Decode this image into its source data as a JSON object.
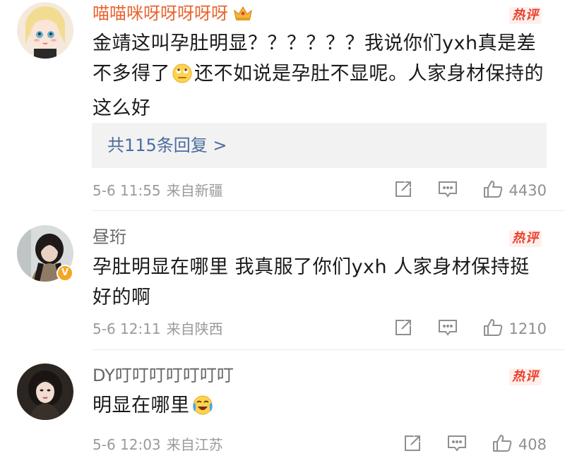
{
  "hot_label": "热评",
  "comments": [
    {
      "username": "喵喵咪呀呀呀呀呀",
      "content_part1": "金靖这叫孕肚明显？？？？？？我说你们yxh真是差不多得了",
      "content_part2": "还不如说是孕肚不显呢。人家身材保持的这么好",
      "replies_label": "共115条回复 >",
      "time": "5-6 11:55",
      "location": "来自新疆",
      "likes": "4430"
    },
    {
      "username": "昼珩",
      "content": "孕肚明显在哪里 我真服了你们yxh 人家身材保持挺好的啊",
      "verified_badge": "V",
      "time": "5-6 12:11",
      "location": "来自陕西",
      "likes": "1210"
    },
    {
      "username": "DY叮叮叮叮叮叮叮",
      "content": "明显在哪里",
      "time": "5-6 12:03",
      "location": "来自江苏",
      "likes": "408"
    }
  ],
  "colors": {
    "username_vip": "#e8652f",
    "username": "#666666",
    "reply_link": "#4a6c9e",
    "hot": "#e8412f",
    "verified": "#f5a623"
  },
  "icons": {
    "crown": "crown-icon",
    "share": "share-icon",
    "reply": "comment-icon",
    "like": "thumbs-up-icon",
    "emoji1": "rolling-eyes-emoji-icon",
    "emoji2": "laugh-cry-emoji-icon"
  }
}
